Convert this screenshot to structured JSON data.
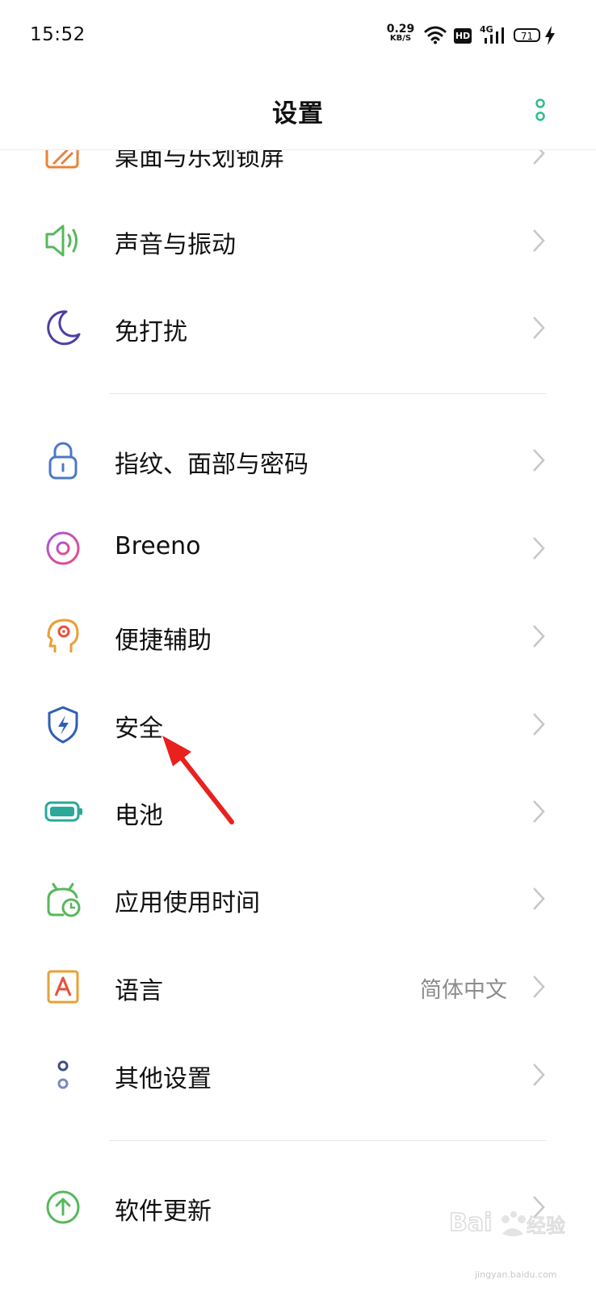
{
  "status_bar": {
    "time": "15:52",
    "net_speed_value": "0.29",
    "net_speed_unit": "KB/S",
    "hd_badge": "HD",
    "network_type": "4G",
    "battery_level": "71"
  },
  "header": {
    "title": "设置",
    "more_icon": "more-vertical-dots-icon"
  },
  "settings_items": [
    {
      "label": "桌面与乐划锁屏",
      "icon": "desktop-lockscreen-icon",
      "color": "#e8823a"
    },
    {
      "label": "声音与振动",
      "icon": "speaker-icon",
      "color": "#56b85a"
    },
    {
      "label": "免打扰",
      "icon": "moon-icon",
      "color": "#4b3fa3"
    },
    {
      "label": "指纹、面部与密码",
      "icon": "lock-icon",
      "color": "#4a78c8"
    },
    {
      "label": "Breeno",
      "icon": "breeno-icon",
      "color": "#d050a0"
    },
    {
      "label": "便捷辅助",
      "icon": "assist-head-icon",
      "color": "#e8a035"
    },
    {
      "label": "安全",
      "icon": "shield-icon",
      "color": "#2f5fb5"
    },
    {
      "label": "电池",
      "icon": "battery-icon",
      "color": "#2aa89a"
    },
    {
      "label": "应用使用时间",
      "icon": "app-time-icon",
      "color": "#56b85a"
    },
    {
      "label": "语言",
      "value": "简体中文",
      "icon": "language-a-icon",
      "color": "#e8a035"
    },
    {
      "label": "其他设置",
      "icon": "other-settings-icon",
      "color": "#5a6aa0"
    },
    {
      "label": "软件更新",
      "icon": "update-arrow-icon",
      "color": "#56b85a"
    }
  ],
  "annotation": {
    "type": "red-arrow",
    "points_to": "安全",
    "color": "#e8201e"
  },
  "watermark": {
    "brand": "Baidu经验",
    "url": "jingyan.baidu.com"
  }
}
